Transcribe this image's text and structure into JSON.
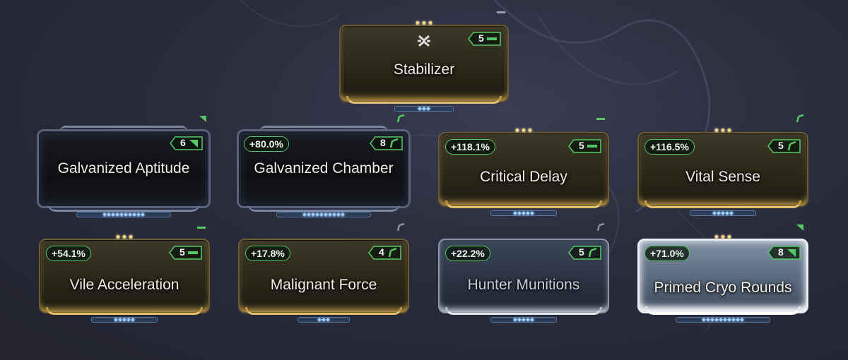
{
  "colors": {
    "stat_border": "#56c964",
    "polarity": "#56c964",
    "rank_star": "#9fd0ff"
  },
  "mods": [
    {
      "name": "Stabilizer",
      "stat": "",
      "drain": "5",
      "polarity": "naramon",
      "style": "gold",
      "ranks_filled": 3,
      "ranks_total": 3
    },
    {
      "name": "Galvanized Aptitude",
      "stat": "",
      "drain": "6",
      "polarity": "madurai",
      "style": "galvanized",
      "ranks_filled": 10,
      "ranks_total": 10
    },
    {
      "name": "Galvanized Chamber",
      "stat": "+80.0%",
      "drain": "8",
      "polarity": "vazarin",
      "style": "galvanized",
      "ranks_filled": 10,
      "ranks_total": 10
    },
    {
      "name": "Critical Delay",
      "stat": "+118.1%",
      "drain": "5",
      "polarity": "naramon",
      "style": "gold",
      "ranks_filled": 5,
      "ranks_total": 5
    },
    {
      "name": "Vital Sense",
      "stat": "+116.5%",
      "drain": "5",
      "polarity": "vazarin",
      "style": "gold",
      "ranks_filled": 5,
      "ranks_total": 5
    },
    {
      "name": "Vile Acceleration",
      "stat": "+54.1%",
      "drain": "5",
      "polarity": "naramon",
      "style": "gold",
      "ranks_filled": 5,
      "ranks_total": 5
    },
    {
      "name": "Malignant Force",
      "stat": "+17.8%",
      "drain": "4",
      "polarity": "vazarin",
      "style": "gold",
      "ranks_filled": 3,
      "ranks_total": 3
    },
    {
      "name": "Hunter Munitions",
      "stat": "+22.2%",
      "drain": "5",
      "polarity": "vazarin",
      "style": "silver",
      "ranks_filled": 5,
      "ranks_total": 5
    },
    {
      "name": "Primed Cryo Rounds",
      "stat": "+71.0%",
      "drain": "8",
      "polarity": "madurai",
      "style": "primed",
      "ranks_filled": 10,
      "ranks_total": 10
    }
  ]
}
